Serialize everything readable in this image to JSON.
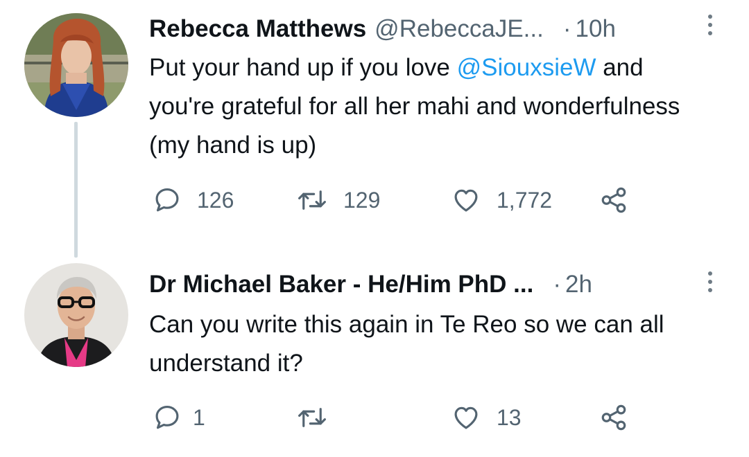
{
  "tweets": [
    {
      "display_name": "Rebecca Matthews",
      "handle": "@RebeccaJE...",
      "separator": "·",
      "time": "10h",
      "text_before": "Put your hand up if you love ",
      "mention": "@SiouxsieW",
      "text_after": " and you're grateful for all her mahi and wonderfulness (my hand is up)",
      "replies": "126",
      "retweets": "129",
      "likes": "1,772"
    },
    {
      "display_name": "Dr Michael Baker - He/Him PhD ...",
      "separator": "·",
      "time": "2h",
      "text": "Can you write this again in Te Reo so we can all understand it?",
      "replies": "1",
      "retweets": "",
      "likes": "13"
    }
  ],
  "icons": {
    "reply": "speech-bubble",
    "retweet": "retweet-arrows",
    "like": "heart",
    "share": "share-nodes",
    "more": "vertical-ellipsis"
  },
  "colors": {
    "text": "#0f1419",
    "secondary": "#536471",
    "mention": "#1d9bf0",
    "thread_line": "#cfd9de"
  }
}
